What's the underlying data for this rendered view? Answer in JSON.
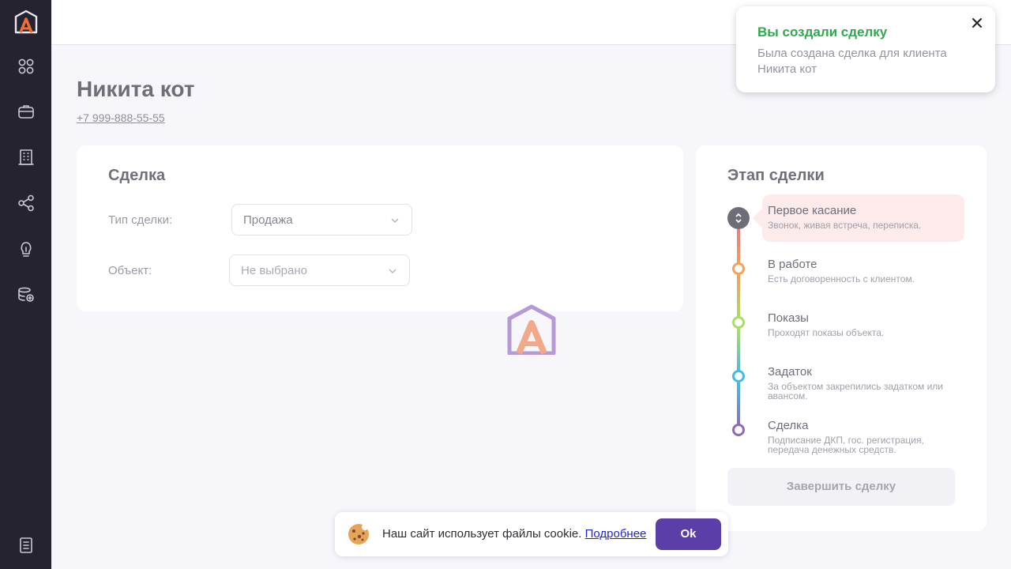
{
  "sidebar": {
    "items": [
      {
        "icon": "grid-icon"
      },
      {
        "icon": "briefcase-icon"
      },
      {
        "icon": "building-icon"
      },
      {
        "icon": "share-icon"
      },
      {
        "icon": "lightbulb-icon"
      },
      {
        "icon": "database-icon"
      }
    ],
    "bottom_icon": "document-icon"
  },
  "client": {
    "name": "Никита кот",
    "phone": "+7 999-888-55-55"
  },
  "deal": {
    "title": "Сделка",
    "type_label": "Тип сделки:",
    "type_value": "Продажа",
    "object_label": "Объект:",
    "object_placeholder": "Не выбрано"
  },
  "stages": {
    "title": "Этап сделки",
    "items": [
      {
        "title": "Первое касание",
        "desc": "Звонок, живая встреча, переписка.",
        "color": "#e57f7f",
        "current": true
      },
      {
        "title": "В работе",
        "desc": "Есть договоренность с клиентом.",
        "color": "#f6a15c"
      },
      {
        "title": "Показы",
        "desc": "Проходят показы объекта.",
        "color": "#a7e05f"
      },
      {
        "title": "Задаток",
        "desc": "За объектом закрепились задатком или авансом.",
        "color": "#46b9e6"
      },
      {
        "title": "Сделка",
        "desc": "Подписание ДКП, гос. регистрация, передача денежных средств.",
        "color": "#8e6cb4"
      }
    ],
    "finish_button": "Завершить сделку"
  },
  "toast": {
    "title": "Вы создали сделку",
    "body": "Была создана сделка для клиента Никита кот",
    "accent": "#2ea94b"
  },
  "cookie": {
    "text": "Наш сайт использует файлы cookie.",
    "link": "Подробнее",
    "button": "Ok",
    "accent": "#5b3ea8"
  }
}
